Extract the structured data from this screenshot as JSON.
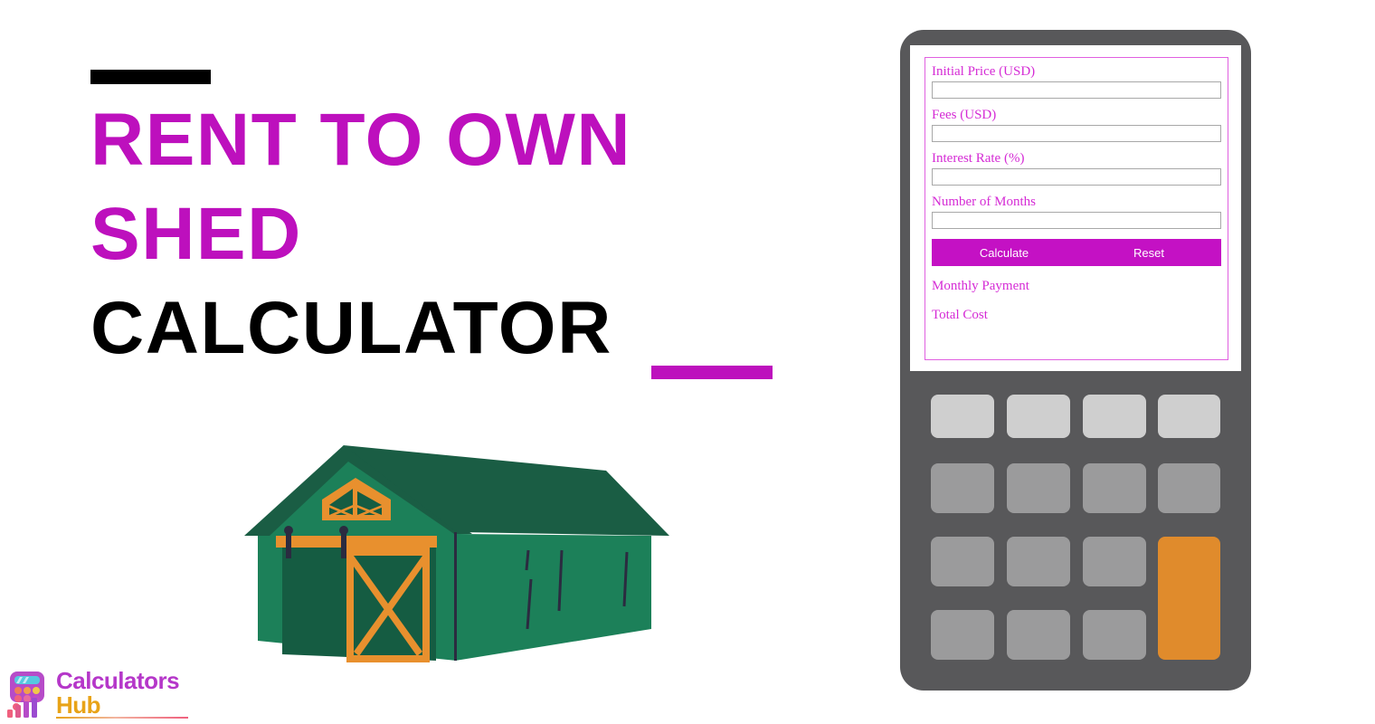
{
  "hero": {
    "title_lines": [
      "Rent to own",
      "Shed",
      "Calculator"
    ],
    "accent_color_purple": "#BD10BD",
    "accent_color_black": "#000000"
  },
  "logo": {
    "word_primary": "Calculators",
    "word_secondary": "Hub",
    "primary_color": "#B537C9",
    "secondary_color": "#E8A317",
    "icon": "calculator-bar-chart-icon"
  },
  "illustration": {
    "name": "shed-barn-illustration",
    "body_color": "#1C8059",
    "roof_color": "#1A5D44",
    "wall_shade_color": "#155C42",
    "trim_color": "#E8902E",
    "hardware_color": "#2B2B40"
  },
  "calculator": {
    "device_color": "#58585A",
    "screen_color": "#FFFFFF",
    "accent_color": "#C411C4",
    "form_border_color": "#E060E0",
    "label_color": "#D52BD5",
    "fields": [
      {
        "label": "Initial Price (USD)",
        "value": "",
        "placeholder": ""
      },
      {
        "label": "Fees (USD)",
        "value": "",
        "placeholder": ""
      },
      {
        "label": "Interest Rate (%)",
        "value": "",
        "placeholder": ""
      },
      {
        "label": "Number of Months",
        "value": "",
        "placeholder": ""
      }
    ],
    "buttons": {
      "calculate_label": "Calculate",
      "reset_label": "Reset"
    },
    "results": [
      {
        "label": "Monthly Payment"
      },
      {
        "label": "Total Cost"
      }
    ],
    "keypad": {
      "rows": 4,
      "columns": 4,
      "light_key_color": "#CFCFCF",
      "mid_key_color": "#9B9B9C",
      "accent_key_color": "#E08B2C"
    }
  }
}
